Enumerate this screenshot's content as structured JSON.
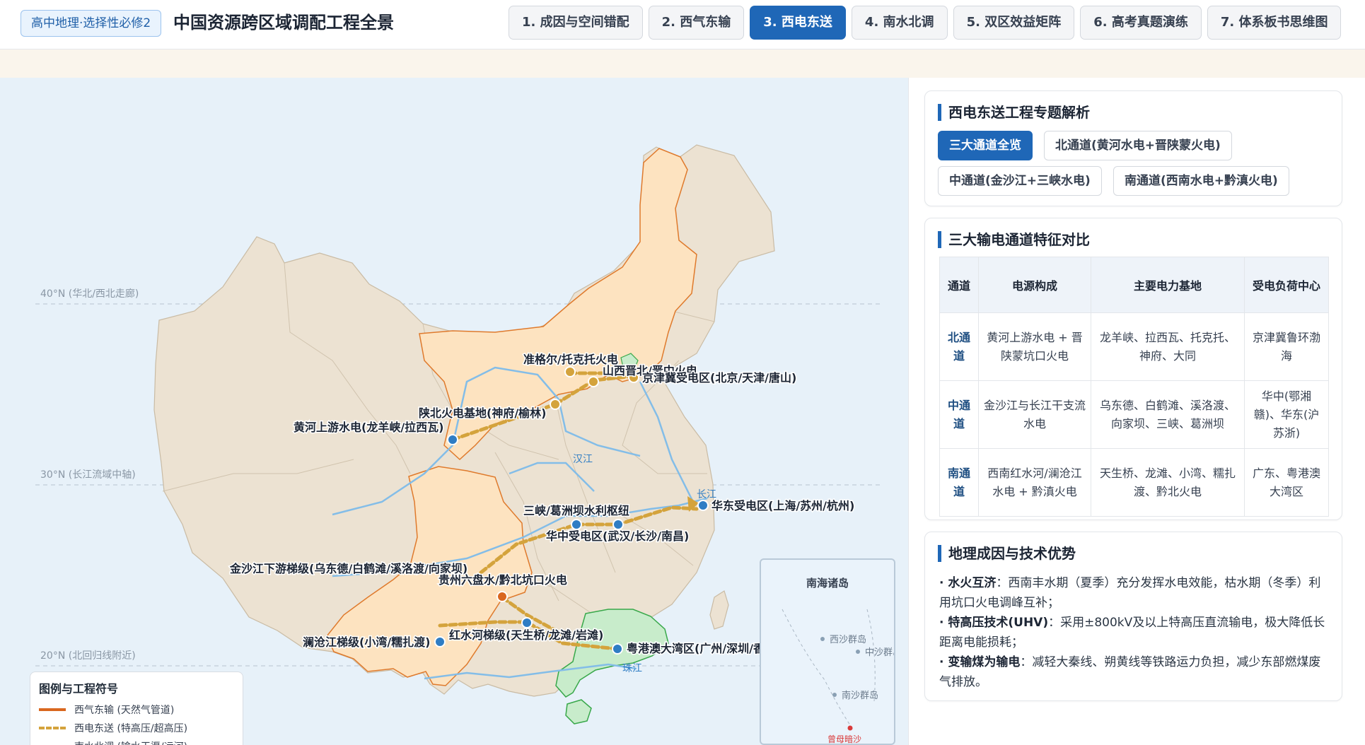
{
  "header": {
    "badge": "高中地理·选择性必修2",
    "title": "中国资源跨区域调配工程全景",
    "tabs": [
      {
        "label": "1. 成因与空间错配",
        "active": false
      },
      {
        "label": "2. 西气东输",
        "active": false
      },
      {
        "label": "3. 西电东送",
        "active": true
      },
      {
        "label": "4. 南水北调",
        "active": false
      },
      {
        "label": "5. 双区效益矩阵",
        "active": false
      },
      {
        "label": "6. 高考真题演练",
        "active": false
      },
      {
        "label": "7. 体系板书思维图",
        "active": false
      }
    ]
  },
  "map": {
    "latitudes": [
      "40°N (华北/西北走廊)",
      "30°N (长江流域中轴)",
      "20°N (北回归线附近)"
    ],
    "rivers": [
      "汉江",
      "长江",
      "珠江"
    ],
    "labels": {
      "zhungeer": "准格尔/托克托火电",
      "shanxi": "山西晋北/晋中火电",
      "jingjinji": "京津冀受电区(北京/天津/唐山)",
      "shaanbei": "陕北火电基地(神府/榆林)",
      "huanghe": "黄河上游水电(龙羊峡/拉西瓦)",
      "sanxia": "三峡/葛洲坝水利枢纽",
      "huadong": "华东受电区(上海/苏州/杭州)",
      "huazhong": "华中受电区(武汉/长沙/南昌)",
      "jinsha": "金沙江下游梯级(乌东德/白鹤滩/溪洛渡/向家坝)",
      "guizhou": "贵州六盘水/黔北坑口火电",
      "hongshui": "红水河梯级(天生桥/龙滩/岩滩)",
      "lancang": "澜沧江梯级(小湾/糯扎渡)",
      "yuegangao": "粤港澳大湾区(广州/深圳/香"
    },
    "legend": {
      "title": "图例与工程符号",
      "items": [
        {
          "label": "西气东输 (天然气管道)",
          "color": "#d9671f",
          "style": "solid"
        },
        {
          "label": "西电东送 (特高压/超高压)",
          "color": "#d4a33c",
          "style": "dashed"
        },
        {
          "label": "南水北调 (输水干渠/运河)",
          "color": "#2f7dc4",
          "style": "solid"
        }
      ]
    },
    "inset": {
      "title": "南海诸岛",
      "islands": [
        "西沙群岛",
        "中沙群岛",
        "南沙群岛",
        "曾母暗沙"
      ]
    }
  },
  "panel": {
    "special": {
      "title": "西电东送工程专题解析",
      "tabs": [
        {
          "label": "三大通道全览",
          "active": true
        },
        {
          "label": "北通道(黄河水电+晋陕蒙火电)",
          "active": false
        },
        {
          "label": "中通道(金沙江+三峡水电)",
          "active": false
        },
        {
          "label": "南通道(西南水电+黔滇火电)",
          "active": false
        }
      ]
    },
    "compare": {
      "title": "三大输电通道特征对比",
      "headers": [
        "通道",
        "电源构成",
        "主要电力基地",
        "受电负荷中心"
      ],
      "rows": [
        [
          "北通道",
          "黄河上游水电 + 晋陕蒙坑口火电",
          "龙羊峡、拉西瓦、托克托、神府、大同",
          "京津冀鲁环渤海"
        ],
        [
          "中通道",
          "金沙江与长江干支流水电",
          "乌东德、白鹤滩、溪洛渡、向家坝、三峡、葛洲坝",
          "华中(鄂湘赣)、华东(沪苏浙)"
        ],
        [
          "南通道",
          "西南红水河/澜沧江水电 + 黔滇火电",
          "天生桥、龙滩、小湾、糯扎渡、黔北火电",
          "广东、粤港澳大湾区"
        ]
      ]
    },
    "geo": {
      "title": "地理成因与技术优势",
      "items": [
        {
          "head": "· 水火互济",
          "text": "：西南丰水期（夏季）充分发挥水电效能，枯水期（冬季）利用坑口火电调峰互补；"
        },
        {
          "head": "· 特高压技术(UHV)",
          "text": "：采用±800kV及以上特高压直流输电，极大降低长距离电能损耗；"
        },
        {
          "head": "· 变输煤为输电",
          "text": "：减轻大秦线、朔黄线等铁路运力负担，减少东部燃煤废气排放。"
        }
      ]
    }
  }
}
